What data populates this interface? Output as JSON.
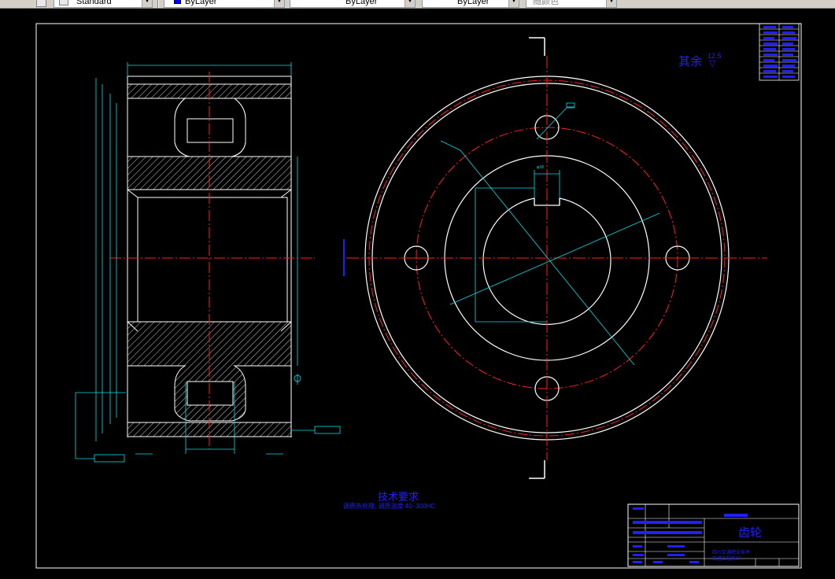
{
  "toolbar": {
    "combos": [
      {
        "id": "textstyle",
        "value": "Standard"
      },
      {
        "id": "layer-color",
        "value": "ByLayer"
      },
      {
        "id": "linetype",
        "value": "ByLayer"
      },
      {
        "id": "lineweight",
        "value": "ByLayer"
      },
      {
        "id": "plotstyle",
        "value": "随颜色"
      }
    ]
  },
  "drawing": {
    "surface_note": "其余",
    "surface_roughness": "12.5",
    "tech_req_title": "技术要求",
    "tech_req_line": "调质热处理, 调质温度 40~300HC",
    "part_name": "齿轮",
    "school_line1": "四川交通职业技术",
    "school_line2": "交通工程系09",
    "hole_dim_label": "φ18",
    "colors": {
      "background": "#000000",
      "outline": "#ffffff",
      "center_line": "#ff2020",
      "dimension": "#00e0e8",
      "text": "#2020ff"
    }
  }
}
